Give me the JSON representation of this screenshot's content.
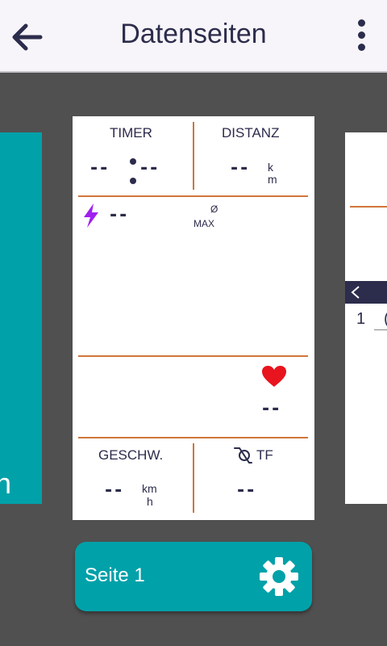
{
  "appbar": {
    "title": "Datenseiten",
    "back_icon": "arrow-left-icon",
    "menu_icon": "kebab-menu-icon"
  },
  "left_card": {
    "fragment": "n"
  },
  "right_card": {
    "number": "1",
    "partial": "("
  },
  "main_card": {
    "timer": {
      "label": "TIMER",
      "value_left": "--",
      "value_right": "--"
    },
    "distance": {
      "label": "DISTANZ",
      "value": "--",
      "unit_top": "k",
      "unit_bottom": "m"
    },
    "power": {
      "value": "--",
      "avg_label": "Ø",
      "max_label": "MAX",
      "icon": "lightning-icon",
      "icon_color": "#a020f0"
    },
    "heart": {
      "value": "--",
      "icon": "heart-icon",
      "icon_color": "#e8141e"
    },
    "speed": {
      "label": "GESCHW.",
      "value": "--",
      "unit_top": "km",
      "unit_bottom": "h"
    },
    "cadence": {
      "label": "TF",
      "value": "--",
      "icon": "cadence-icon"
    }
  },
  "page_button": {
    "label": "Seite 1",
    "icon": "gear-icon"
  },
  "colors": {
    "accent": "#00a1a9",
    "divider": "#d0763a",
    "text": "#2c2c4c",
    "background": "#505050"
  }
}
